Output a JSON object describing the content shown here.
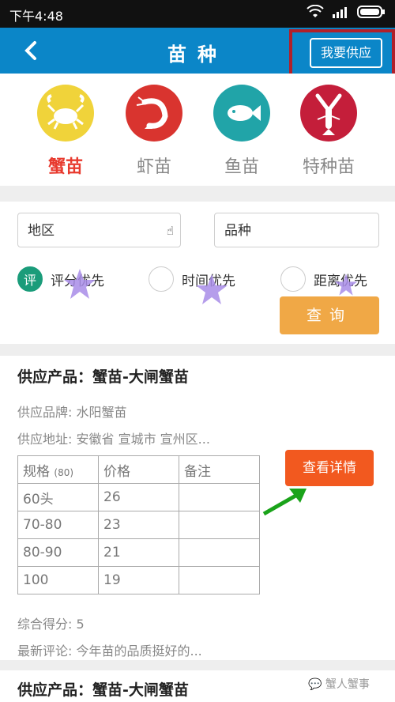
{
  "status_bar": {
    "time": "下午4:48"
  },
  "header": {
    "title": "苗种",
    "supply_button": "我要供应"
  },
  "categories": [
    {
      "label": "蟹苗",
      "icon": "crab-icon",
      "color": "#f0d33a"
    },
    {
      "label": "虾苗",
      "icon": "shrimp-icon",
      "color": "#d9342f"
    },
    {
      "label": "鱼苗",
      "icon": "fish-icon",
      "color": "#21a4a8"
    },
    {
      "label": "特种苗",
      "icon": "lobster-icon",
      "color": "#c41e3a"
    }
  ],
  "filters": {
    "region": "地区",
    "variety": "品种",
    "sort_options": [
      {
        "label": "评分优先",
        "mark": "评"
      },
      {
        "label": "时间优先"
      },
      {
        "label": "距离优先"
      }
    ],
    "query_button": "查询"
  },
  "listing": {
    "product": "供应产品：蟹苗-大闸蟹苗",
    "brand": "供应品牌: 水阳蟹苗",
    "location": "供应地址: 安徽省 宣城市 宣州区...",
    "table": {
      "headers": [
        "规格",
        "价格",
        "备注"
      ],
      "header_note": "(80)",
      "rows": [
        [
          "60头",
          "26",
          ""
        ],
        [
          "70-80",
          "23",
          ""
        ],
        [
          "80-90",
          "21",
          ""
        ],
        [
          "100",
          "19",
          ""
        ]
      ]
    },
    "detail_button": "查看详情",
    "score": "综合得分: 5",
    "comment": "最新评论: 今年苗的品质挺好的..."
  },
  "listing2": {
    "product": "供应产品：蟹苗-大闸蟹苗"
  },
  "watermark": "蟹人蟹事",
  "colors": {
    "header": "#0b86c8",
    "accent_red": "#e83a2e",
    "query": "#f0a846",
    "detail": "#f2591f"
  }
}
